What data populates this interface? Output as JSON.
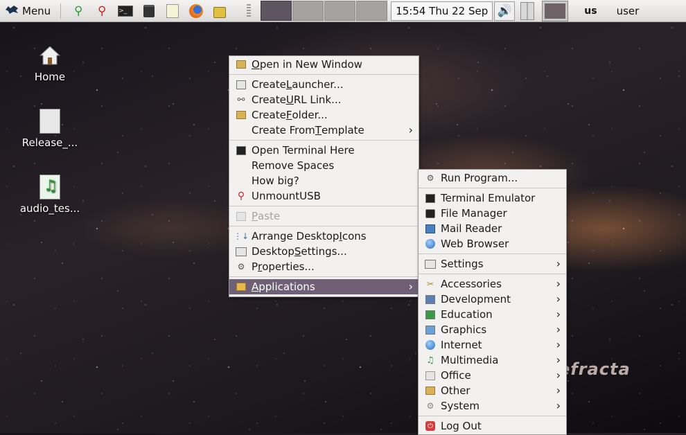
{
  "panel": {
    "menu_label": "Menu",
    "clock": "15:54  Thu 22 Sep",
    "keyboard_layout": "us",
    "user": "user",
    "workspaces": 4,
    "active_workspace": 1,
    "launchers": [
      "usb-green-icon",
      "usb-red-icon",
      "terminal-icon",
      "file-manager-icon",
      "text-editor-icon",
      "firefox-icon",
      "lock-icon"
    ]
  },
  "desktop": {
    "icons": [
      {
        "label": "Home"
      },
      {
        "label": "Release_..."
      },
      {
        "label": "audio_tes..."
      }
    ],
    "watermark": "efracta"
  },
  "context_menu": {
    "open_new_window": {
      "pre": "",
      "u": "O",
      "post": "pen in New Window"
    },
    "create_launcher": {
      "pre": "Create ",
      "u": "L",
      "post": "auncher..."
    },
    "create_url_link": {
      "pre": "Create ",
      "u": "U",
      "post": "RL Link..."
    },
    "create_folder": {
      "pre": "Create ",
      "u": "F",
      "post": "older..."
    },
    "create_from_template": {
      "pre": "Create From ",
      "u": "T",
      "post": "emplate"
    },
    "open_terminal": "Open Terminal Here",
    "remove_spaces": "Remove Spaces",
    "how_big": "How big?",
    "unmount_usb": "UnmountUSB",
    "paste": {
      "pre": "",
      "u": "P",
      "post": "aste"
    },
    "arrange_icons": {
      "pre": "Arrange Desktop ",
      "u": "I",
      "post": "cons"
    },
    "desktop_settings": {
      "pre": "Desktop ",
      "u": "S",
      "post": "ettings..."
    },
    "properties": {
      "pre": "P",
      "u": "r",
      "post": "operties..."
    },
    "applications": {
      "pre": "",
      "u": "A",
      "post": "pplications"
    }
  },
  "apps_menu": {
    "run_program": "Run Program...",
    "terminal_emulator": "Terminal Emulator",
    "file_manager": "File Manager",
    "mail_reader": "Mail Reader",
    "web_browser": "Web Browser",
    "settings": "Settings",
    "categories": [
      "Accessories",
      "Development",
      "Education",
      "Graphics",
      "Internet",
      "Multimedia",
      "Office",
      "Other",
      "System"
    ],
    "log_out": "Log Out"
  },
  "colors": {
    "highlight": "#6f6075",
    "panel": "#e8e7e5",
    "menu_bg": "#f2f1f0"
  }
}
